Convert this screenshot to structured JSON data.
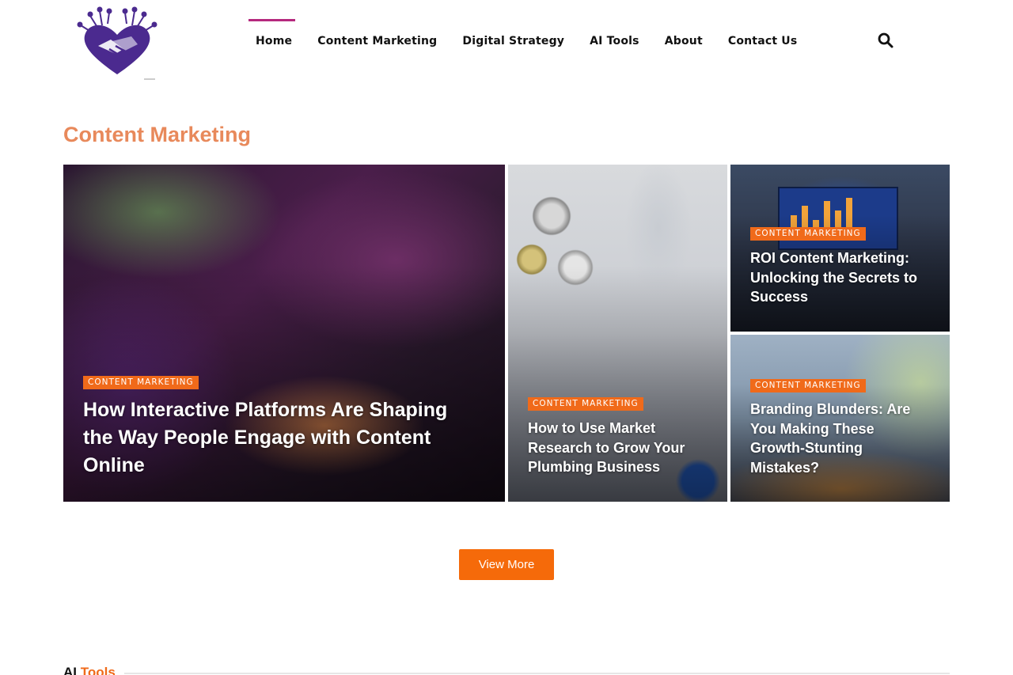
{
  "header": {
    "logo_name": "handshake-logo",
    "nav": [
      {
        "label": "Home",
        "active": true
      },
      {
        "label": "Content Marketing"
      },
      {
        "label": "Digital Strategy"
      },
      {
        "label": "AI Tools"
      },
      {
        "label": "About"
      },
      {
        "label": "Contact Us"
      }
    ],
    "search_icon": "search-icon"
  },
  "section": {
    "title": "Content Marketing"
  },
  "posts": [
    {
      "category": "CONTENT MARKETING",
      "title": "How Interactive Platforms Are Shaping the Way People Engage with Content Online"
    },
    {
      "category": "CONTENT MARKETING",
      "title": "How to Use Market Research to Grow Your Plumbing Business"
    },
    {
      "category": "CONTENT MARKETING",
      "title": "ROI Content Marketing: Unlocking the Secrets to Success"
    },
    {
      "category": "CONTENT MARKETING",
      "title": "Branding Blunders: Are You Making These Growth-Stunting Mistakes?"
    }
  ],
  "view_more_label": "View More",
  "next_section": {
    "title_part1": "AI",
    "title_part2": "Tools"
  },
  "colors": {
    "accent": "#f06a1a",
    "section_title": "#e8895b",
    "nav_active": "#b5297e",
    "logo": "#4b2a8f"
  }
}
